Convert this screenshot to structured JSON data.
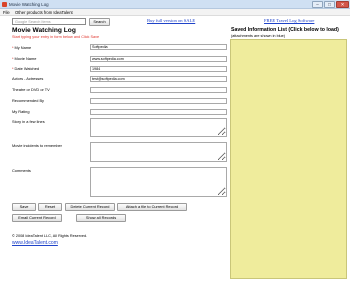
{
  "window": {
    "title": "Movie Watching Log",
    "minimize_glyph": "–",
    "maximize_glyph": "□",
    "close_glyph": "✕"
  },
  "menu": {
    "items": [
      "File",
      "Other products from IdeaTalent"
    ]
  },
  "search": {
    "placeholder": "Google Search Items",
    "button_label": "Search"
  },
  "links": {
    "sale": "Buy full version on SALE",
    "free_software": "FREE Travel Log Software"
  },
  "form": {
    "title": "Movie Watching Log",
    "hint": "Start typing your entry in form below and Click Save",
    "required_mark": "*",
    "fields": {
      "my_name": {
        "label": "My Name",
        "value": "Softpedia"
      },
      "movie_name": {
        "label": "Movie Name",
        "value": "www.softpedia.com"
      },
      "date_watched": {
        "label": "Date Watched",
        "value": "1984"
      },
      "actors": {
        "label": "Actors - Actresses",
        "value": "test@softpedia.com"
      },
      "theatre": {
        "label": "Theatre or DVD or TV",
        "value": ""
      },
      "recommended_by": {
        "label": "Recommended By",
        "value": ""
      },
      "my_rating": {
        "label": "My Rating",
        "value": ""
      },
      "story": {
        "label": "Story in a few lines",
        "value": ""
      },
      "incidents": {
        "label": "Movie incidents to remember",
        "value": ""
      },
      "comments": {
        "label": "Comments",
        "value": ""
      }
    }
  },
  "saved_list": {
    "heading": "Saved Information List (Click below to load)",
    "subheading": "(attachments are shown in blue)"
  },
  "buttons": {
    "save": "Save",
    "reset": "Reset",
    "delete_current": "Delete Current Record",
    "attach_file": "Attach a file to Current Record",
    "email_current": "Email Current Record",
    "show_all": "Show all Records"
  },
  "footer": {
    "copyright": "© 2008 IdeaTalent LLC, All Rights Reserved.",
    "website": "www.IdeaTalent.com"
  }
}
